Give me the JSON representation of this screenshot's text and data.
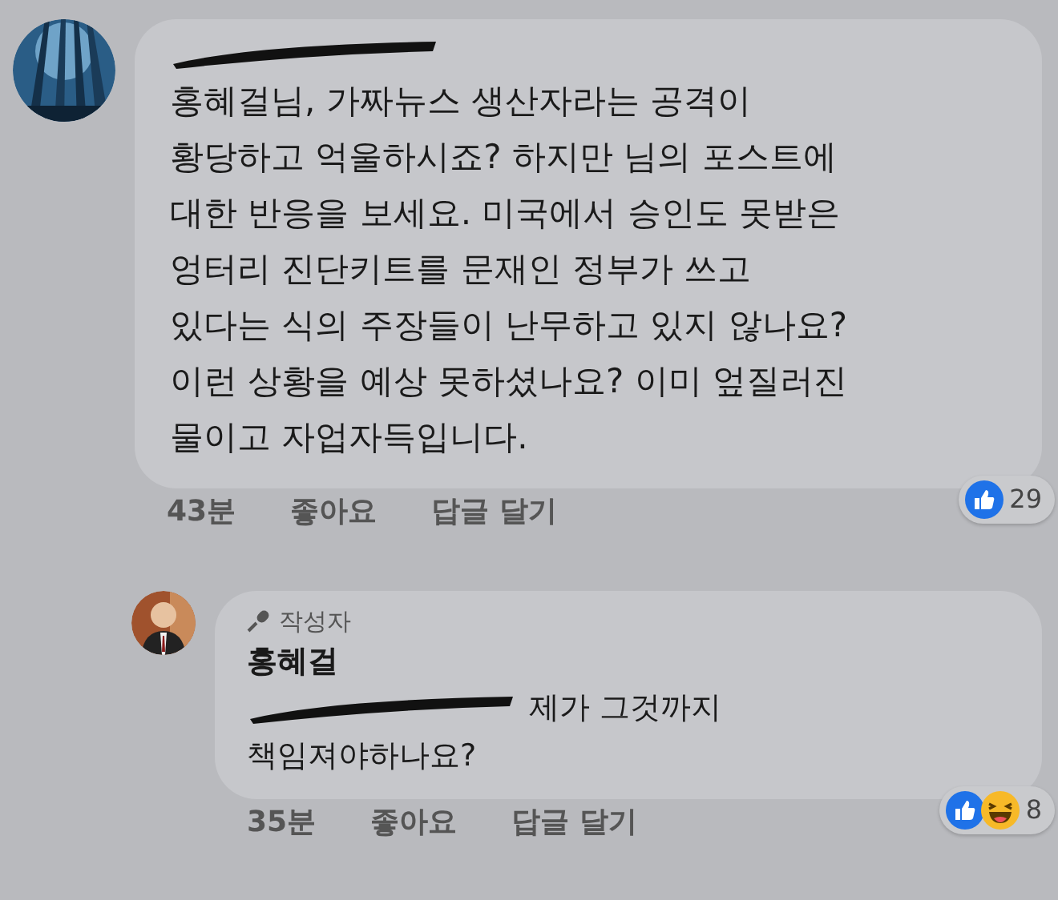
{
  "comments": [
    {
      "kind": "comment",
      "author_redacted": true,
      "text_lines": [
        "홍혜걸님, 가짜뉴스 생산자라는 공격이",
        "황당하고 억울하시죠? 하지만 님의 포스트에",
        "대한 반응을 보세요. 미국에서 승인도 못받은",
        "엉터리 진단키트를 문재인 정부가 쓰고",
        "있다는 식의 주장들이 난무하고 있지 않나요?",
        "이런 상황을 예상 못하셨나요? 이미 엎질러진",
        "물이고 자업자득입니다."
      ],
      "time": "43분",
      "like": "좋아요",
      "reply": "답글 달기",
      "reactions": [
        {
          "kind": "like"
        }
      ],
      "reaction_count": "29"
    },
    {
      "kind": "reply",
      "author_badge": "작성자",
      "author": "홍혜걸",
      "mention_redacted": true,
      "text_lines": [
        "제가 그것까지",
        "책임져야하나요?"
      ],
      "time": "35분",
      "like": "좋아요",
      "reply": "답글 달기",
      "reactions": [
        {
          "kind": "like"
        },
        {
          "kind": "haha"
        }
      ],
      "reaction_count": "8"
    }
  ]
}
